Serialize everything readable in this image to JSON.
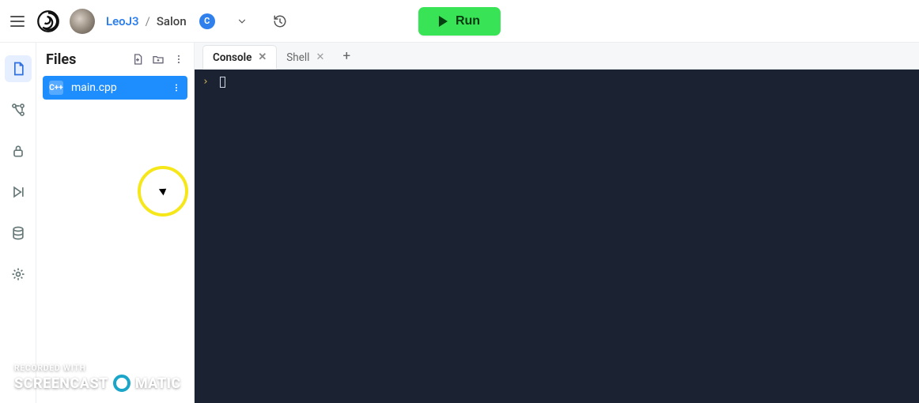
{
  "header": {
    "user": "LeoJ3",
    "separator": "/",
    "project": "Salon",
    "lang_badge": "C",
    "run_label": "Run"
  },
  "sidebar_tools": {
    "files": "files-icon",
    "vcs": "vcs-icon",
    "lock": "lock-icon",
    "play_step": "play-step-icon",
    "database": "database-icon",
    "settings": "gear-icon"
  },
  "files_panel": {
    "title": "Files",
    "items": [
      {
        "badge": "C++",
        "name": "main.cpp"
      }
    ]
  },
  "tabs": [
    {
      "label": "Console",
      "active": true
    },
    {
      "label": "Shell",
      "active": false
    }
  ],
  "console": {
    "prompt": "›"
  },
  "watermark": {
    "line1": "RECORDED WITH",
    "brand_left": "SCREENCAST",
    "brand_right": "MATIC"
  }
}
